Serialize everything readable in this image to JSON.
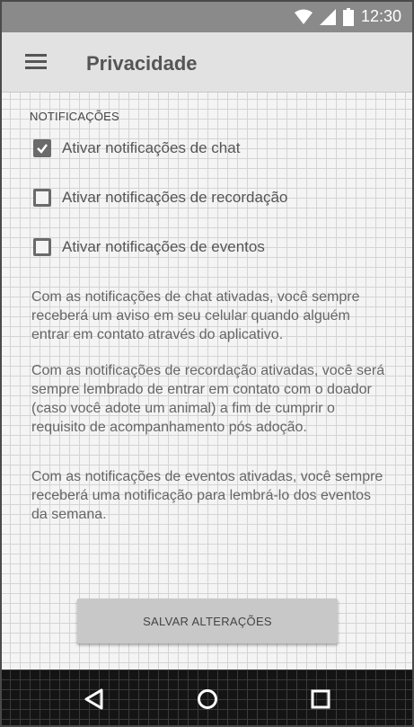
{
  "status_bar": {
    "time": "12:30",
    "icons": [
      "wifi-icon",
      "signal-icon",
      "battery-icon"
    ]
  },
  "app_bar": {
    "title": "Privacidade",
    "menu_icon": "menu-icon"
  },
  "notifications": {
    "section_title": "NOTIFICAÇÕES",
    "options": [
      {
        "label": "Ativar notificações de chat",
        "checked": true
      },
      {
        "label": "Ativar notificações de recordação",
        "checked": false
      },
      {
        "label": "Ativar notificações de eventos",
        "checked": false
      }
    ],
    "descriptions": [
      "Com as notificações de chat ativadas, você sempre receberá um aviso em seu celular quando alguém entrar em contato através do aplicativo.",
      "Com as notificações de recordação ativadas, você será sempre lembrado de entrar em contato com o doador (caso você adote um animal) a fim de cumprir o requisito de acompanhamento pós adoção.",
      "Com as notificações de eventos ativadas, você sempre receberá uma notificação para lembrá-lo dos eventos da semana."
    ]
  },
  "actions": {
    "save_label": "SALVAR ALTERAÇÕES"
  },
  "nav_bar": {
    "icons": [
      "back-icon",
      "home-icon",
      "recents-icon"
    ]
  }
}
